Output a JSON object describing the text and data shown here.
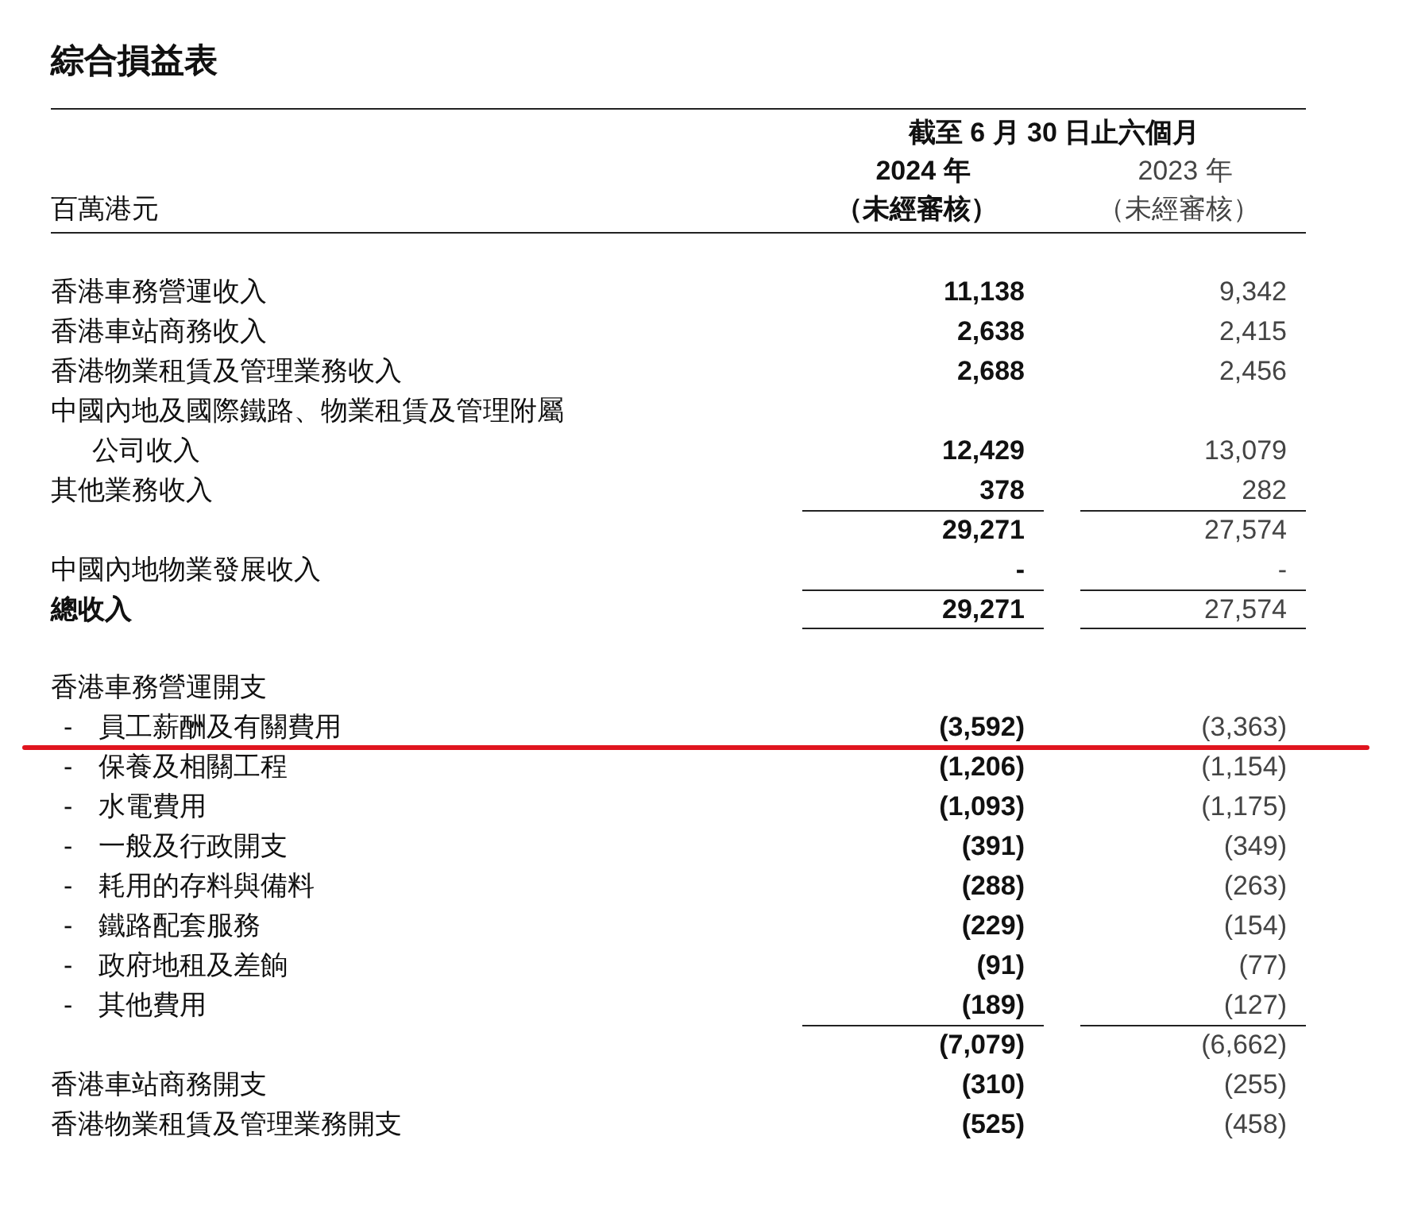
{
  "title": "綜合損益表",
  "header": {
    "period": "截至 6 月 30 日止六個月",
    "unit": "百萬港元",
    "columns": [
      {
        "year": "2024 年",
        "note": "（未經審核）",
        "bold": true
      },
      {
        "year": "2023 年",
        "note": "（未經審核）",
        "bold": false
      }
    ]
  },
  "rows": [
    {
      "kind": "gap",
      "marked": false
    },
    {
      "kind": "item",
      "label": "香港車務營運收入",
      "values": [
        "11,138",
        "9,342"
      ],
      "marked": false
    },
    {
      "kind": "item",
      "label": "香港車站商務收入",
      "values": [
        "2,638",
        "2,415"
      ],
      "marked": false
    },
    {
      "kind": "item",
      "label": "香港物業租賃及管理業務收入",
      "values": [
        "2,688",
        "2,456"
      ],
      "marked": false
    },
    {
      "kind": "item",
      "label": "中國內地及國際鐵路、物業租賃及管理附屬",
      "marked": false
    },
    {
      "kind": "cont",
      "label": "公司收入",
      "values": [
        "12,429",
        "13,079"
      ],
      "marked": false
    },
    {
      "kind": "item",
      "label": "其他業務收入",
      "values": [
        "378",
        "282"
      ],
      "marked": false
    },
    {
      "kind": "subtotal",
      "values": [
        "29,271",
        "27,574"
      ],
      "marked": false
    },
    {
      "kind": "item",
      "label": "中國內地物業發展收入",
      "values": [
        "-",
        "-"
      ],
      "marked": false
    },
    {
      "kind": "total",
      "label": "總收入",
      "values": [
        "29,271",
        "27,574"
      ],
      "marked": false
    },
    {
      "kind": "gap",
      "marked": false
    },
    {
      "kind": "item",
      "label": "香港車務營運開支",
      "marked": false
    },
    {
      "kind": "sub",
      "dash": "-",
      "label": "員工薪酬及有關費用",
      "values": [
        "(3,592)",
        "(3,363)"
      ],
      "marked": true
    },
    {
      "kind": "sub",
      "dash": "-",
      "label": "保養及相關工程",
      "values": [
        "(1,206)",
        "(1,154)"
      ],
      "marked": false
    },
    {
      "kind": "sub",
      "dash": "-",
      "label": "水電費用",
      "values": [
        "(1,093)",
        "(1,175)"
      ],
      "marked": false
    },
    {
      "kind": "sub",
      "dash": "-",
      "label": "一般及行政開支",
      "values": [
        "(391)",
        "(349)"
      ],
      "marked": false
    },
    {
      "kind": "sub",
      "dash": "-",
      "label": "耗用的存料與備料",
      "values": [
        "(288)",
        "(263)"
      ],
      "marked": false
    },
    {
      "kind": "sub",
      "dash": "-",
      "label": "鐵路配套服務",
      "values": [
        "(229)",
        "(154)"
      ],
      "marked": false
    },
    {
      "kind": "sub",
      "dash": "-",
      "label": "政府地租及差餉",
      "values": [
        "(91)",
        "(77)"
      ],
      "marked": false
    },
    {
      "kind": "sub",
      "dash": "-",
      "label": "其他費用",
      "values": [
        "(189)",
        "(127)"
      ],
      "marked": false
    },
    {
      "kind": "subtotal",
      "values": [
        "(7,079)",
        "(6,662)"
      ],
      "marked": false
    },
    {
      "kind": "item",
      "label": "香港車站商務開支",
      "values": [
        "(310)",
        "(255)"
      ],
      "marked": false
    },
    {
      "kind": "item",
      "label": "香港物業租賃及管理業務開支",
      "values": [
        "(525)",
        "(458)"
      ],
      "marked": false
    }
  ]
}
